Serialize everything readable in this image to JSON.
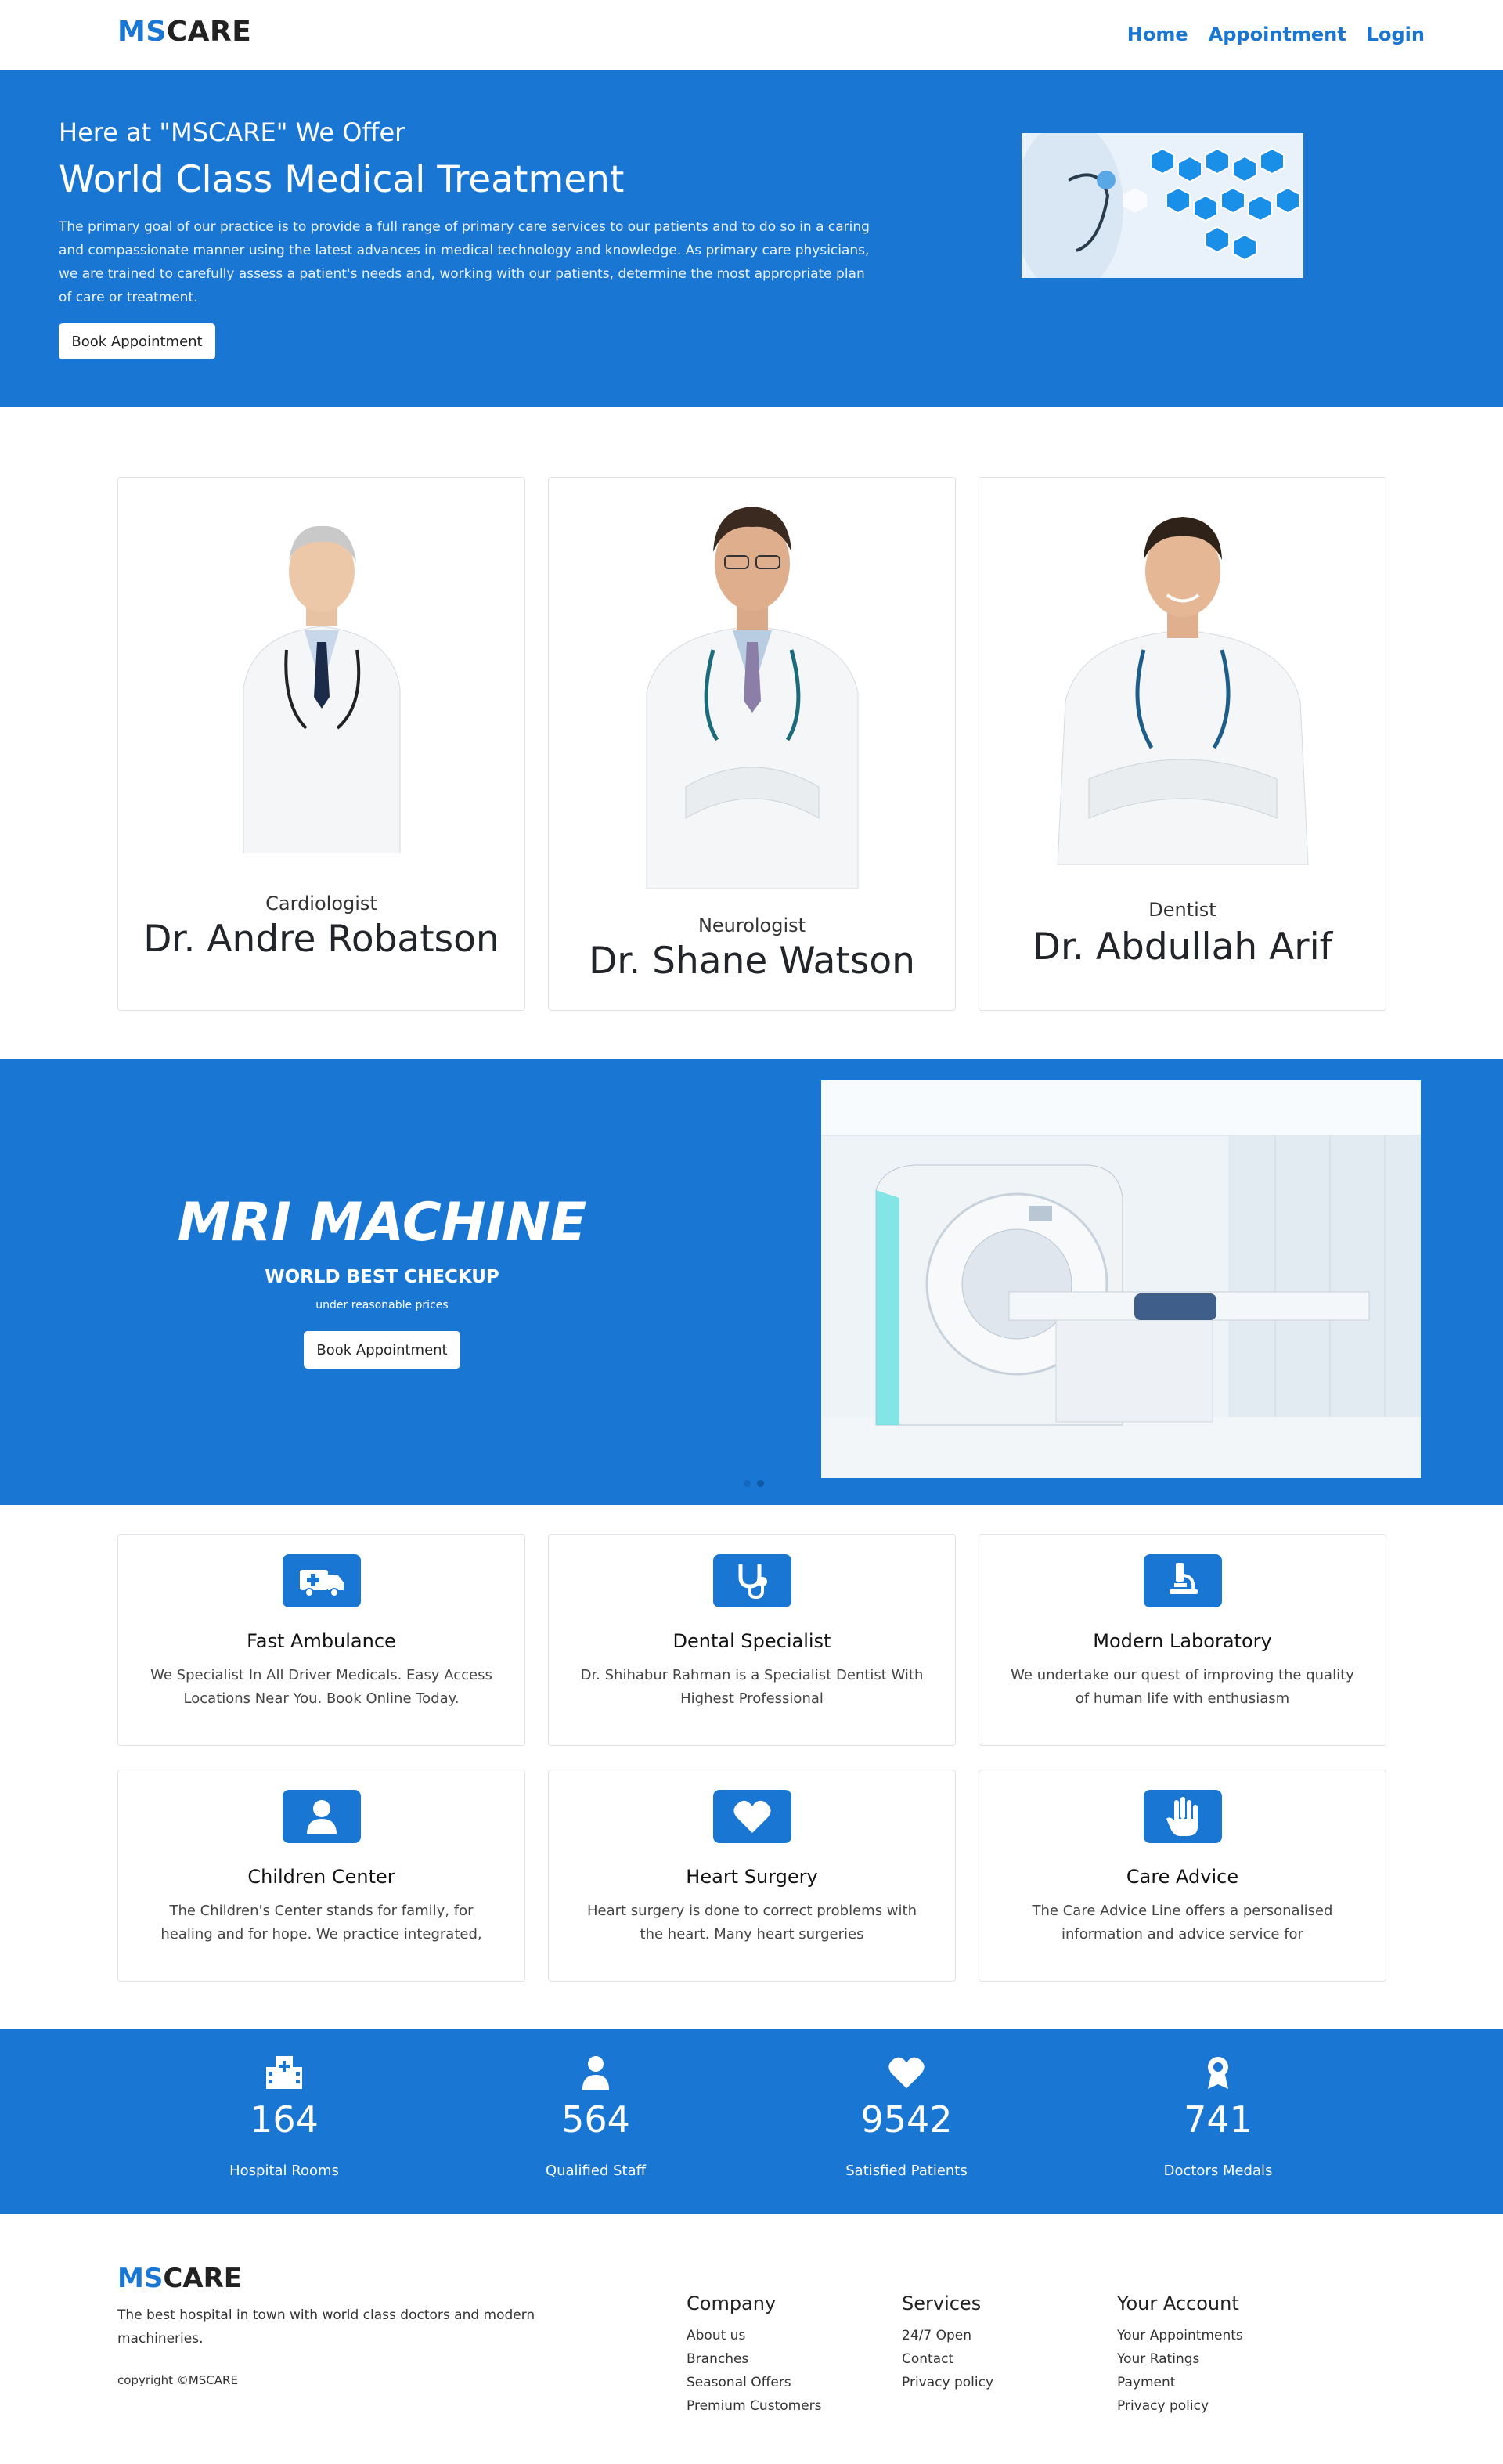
{
  "nav": {
    "brand_ms": "MS",
    "brand_care": "CARE",
    "links": [
      "Home",
      "Appointment",
      "Login"
    ]
  },
  "hero": {
    "pre_title": "Here at \"MSCARE\" We Offer",
    "title": "World Class Medical Treatment",
    "text": "The primary goal of our practice is to provide a full range of primary care services to our patients and to do so in a caring and compassionate manner using the latest advances in medical technology and knowledge. As primary care physicians, we are trained to carefully assess a patient's needs and, working with our patients, determine the most appropriate plan of care or treatment.",
    "button": "Book Appointment"
  },
  "doctors": [
    {
      "specialty": "Cardiologist",
      "name": "Dr. Andre Robatson"
    },
    {
      "specialty": "Neurologist",
      "name": "Dr. Shane Watson"
    },
    {
      "specialty": "Dentist",
      "name": "Dr. Abdullah Arif"
    }
  ],
  "mri": {
    "title": "MRI MACHINE",
    "subtitle": "WORLD BEST CHECKUP",
    "note": "under reasonable prices",
    "button": "Book Appointment"
  },
  "services": [
    {
      "icon": "ambulance-icon",
      "title": "Fast Ambulance",
      "desc": "We Specialist In All Driver Medicals. Easy Access Locations Near You. Book Online Today."
    },
    {
      "icon": "stethoscope-icon",
      "title": "Dental Specialist",
      "desc": "Dr. Shihabur Rahman is a Specialist Dentist With Highest Professional"
    },
    {
      "icon": "microscope-icon",
      "title": "Modern Laboratory",
      "desc": "We undertake our quest of improving the quality of human life with enthusiasm"
    },
    {
      "icon": "user-icon",
      "title": "Children Center",
      "desc": "The Children's Center stands for family, for healing and for hope. We practice integrated,"
    },
    {
      "icon": "heart-icon",
      "title": "Heart Surgery",
      "desc": "Heart surgery is done to correct problems with the heart. Many heart surgeries"
    },
    {
      "icon": "hand-icon",
      "title": "Care Advice",
      "desc": "The Care Advice Line offers a personalised information and advice service for"
    }
  ],
  "stats": [
    {
      "icon": "hospital-icon",
      "value": "164",
      "label": "Hospital Rooms"
    },
    {
      "icon": "user-icon",
      "value": "564",
      "label": "Qualified Staff"
    },
    {
      "icon": "heart-icon",
      "value": "9542",
      "label": "Satisfied Patients"
    },
    {
      "icon": "medal-icon",
      "value": "741",
      "label": "Doctors Medals"
    }
  ],
  "footer": {
    "brand_ms": "MS",
    "brand_care": "CARE",
    "desc": "The best hospital in town with world class doctors and modern machineries.",
    "copyright": "copyright ©MSCARE",
    "columns": [
      {
        "title": "Company",
        "links": [
          "About us",
          "Branches",
          "Seasonal Offers",
          "Premium Customers"
        ]
      },
      {
        "title": "Services",
        "links": [
          "24/7 Open",
          "Contact",
          "Privacy policy"
        ]
      },
      {
        "title": "Your Account",
        "links": [
          "Your Appointments",
          "Your Ratings",
          "Payment",
          "Privacy policy"
        ]
      }
    ]
  },
  "colors": {
    "primary": "#1976d2",
    "white": "#ffffff",
    "text": "#212529"
  }
}
